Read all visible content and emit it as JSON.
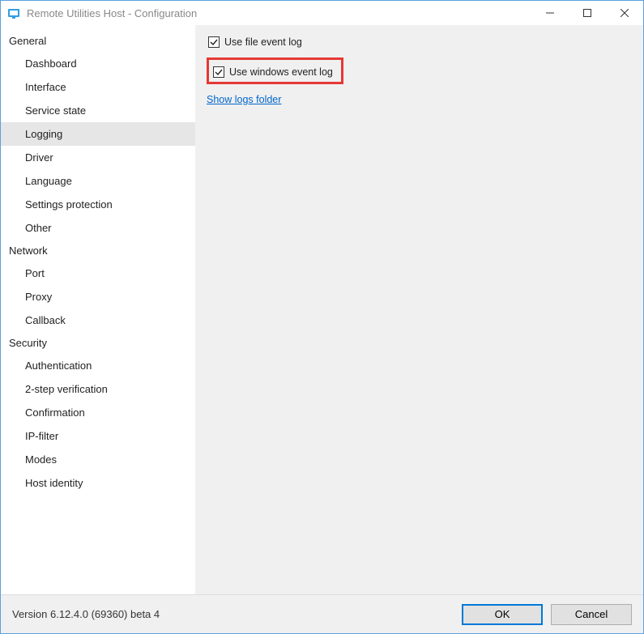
{
  "window": {
    "title": "Remote Utilities Host - Configuration"
  },
  "sidebar": {
    "sections": [
      {
        "header": "General",
        "items": [
          {
            "label": "Dashboard",
            "selected": false
          },
          {
            "label": "Interface",
            "selected": false
          },
          {
            "label": "Service state",
            "selected": false
          },
          {
            "label": "Logging",
            "selected": true
          },
          {
            "label": "Driver",
            "selected": false
          },
          {
            "label": "Language",
            "selected": false
          },
          {
            "label": "Settings protection",
            "selected": false
          },
          {
            "label": "Other",
            "selected": false
          }
        ]
      },
      {
        "header": "Network",
        "items": [
          {
            "label": "Port",
            "selected": false
          },
          {
            "label": "Proxy",
            "selected": false
          },
          {
            "label": "Callback",
            "selected": false
          }
        ]
      },
      {
        "header": "Security",
        "items": [
          {
            "label": "Authentication",
            "selected": false
          },
          {
            "label": "2-step verification",
            "selected": false
          },
          {
            "label": "Confirmation",
            "selected": false
          },
          {
            "label": "IP-filter",
            "selected": false
          },
          {
            "label": "Modes",
            "selected": false
          },
          {
            "label": "Host identity",
            "selected": false
          }
        ]
      }
    ]
  },
  "content": {
    "use_file_event_log": {
      "label": "Use file event log",
      "checked": true
    },
    "use_windows_event_log": {
      "label": "Use windows event log",
      "checked": true,
      "highlighted": true
    },
    "show_logs_link": "Show logs folder"
  },
  "footer": {
    "version": "Version 6.12.4.0 (69360) beta 4",
    "ok_label": "OK",
    "cancel_label": "Cancel"
  }
}
